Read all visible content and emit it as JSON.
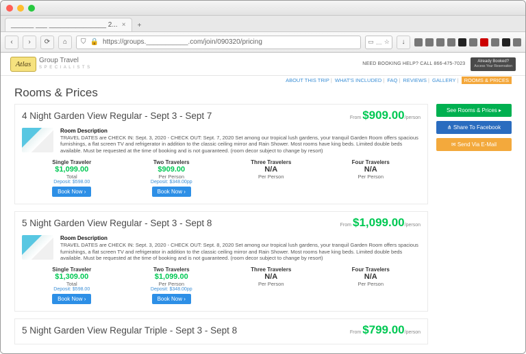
{
  "browser": {
    "tab_title": "______ ___ _______________ 2...",
    "url": "https://groups.___________.com/join/090320/pricing"
  },
  "siteheader": {
    "logo_badge": "Atlas",
    "brand_main": "Group Travel",
    "brand_sub": "S P E C I A L I S T S",
    "help_text": "NEED BOOKING HELP? CALL 866-475-7023",
    "already_top": "Already Booked?",
    "already_sub": "Access Your Reservation"
  },
  "nav": {
    "about": "ABOUT THIS TRIP",
    "included": "WHAT'S INCLUDED",
    "faq": "FAQ",
    "reviews": "REVIEWS",
    "gallery": "GALLERY",
    "rooms": "ROOMS & PRICES"
  },
  "heading": "Rooms & Prices",
  "sidebar": {
    "see_rooms": "See Rooms & Prices ▸",
    "share_fb": "⋔ Share To Facebook",
    "send_mail": "✉ Send Via E-Mail"
  },
  "rooms": [
    {
      "title": "4 Night Garden View Regular - Sept 3 - Sept 7",
      "from_label": "From",
      "headline_price": "$909.00",
      "per_person": "/person",
      "desc_title": "Room Description",
      "desc": "TRAVEL DATES are CHECK IN: Sept. 3, 2020 - CHECK OUT: Sept. 7, 2020 Set among our tropical lush gardens, your tranquil Garden Room offers spacious furnishings, a flat screen TV and refrigerator in addition to the classic ceiling mirror and Rain Shower. Most rooms have king beds. Limited double beds available. Must be requested at the time of booking and is not guaranteed. (room decor subject to change by resort)",
      "cols": [
        {
          "label": "Single Traveler",
          "amount": "$1,099.00",
          "na": false,
          "sub": "Total",
          "deposit": "Deposit: $598.00",
          "book": "Book Now ›"
        },
        {
          "label": "Two Travelers",
          "amount": "$909.00",
          "na": false,
          "sub": "Per Person",
          "deposit": "Deposit: $348.00pp",
          "book": "Book Now ›"
        },
        {
          "label": "Three Travelers",
          "amount": "N/A",
          "na": true,
          "sub": "Per Person",
          "deposit": "",
          "book": ""
        },
        {
          "label": "Four Travelers",
          "amount": "N/A",
          "na": true,
          "sub": "Per Person",
          "deposit": "",
          "book": ""
        }
      ]
    },
    {
      "title": "5 Night Garden View Regular - Sept 3 - Sept 8",
      "from_label": "From",
      "headline_price": "$1,099.00",
      "per_person": "/person",
      "desc_title": "Room Description",
      "desc": "TRAVEL DATES are CHECK IN: Sept. 3, 2020 - CHECK OUT: Sept. 8, 2020 Set among our tropical lush gardens, your tranquil Garden Room offers spacious furnishings, a flat screen TV and refrigerator in addition to the classic ceiling mirror and Rain Shower. Most rooms have king beds. Limited double beds available. Must be requested at the time of booking and is not guaranteed. (room decor subject to change by resort)",
      "cols": [
        {
          "label": "Single Traveler",
          "amount": "$1,309.00",
          "na": false,
          "sub": "Total",
          "deposit": "Deposit: $598.00",
          "book": "Book Now ›"
        },
        {
          "label": "Two Travelers",
          "amount": "$1,099.00",
          "na": false,
          "sub": "Per Person",
          "deposit": "Deposit: $348.00pp",
          "book": "Book Now ›"
        },
        {
          "label": "Three Travelers",
          "amount": "N/A",
          "na": true,
          "sub": "Per Person",
          "deposit": "",
          "book": ""
        },
        {
          "label": "Four Travelers",
          "amount": "N/A",
          "na": true,
          "sub": "Per Person",
          "deposit": "",
          "book": ""
        }
      ]
    },
    {
      "title": "5 Night Garden View Regular Triple - Sept 3 - Sept 8",
      "from_label": "From",
      "headline_price": "$799.00",
      "per_person": "/person",
      "desc_title": "",
      "desc": "",
      "cols": []
    }
  ]
}
